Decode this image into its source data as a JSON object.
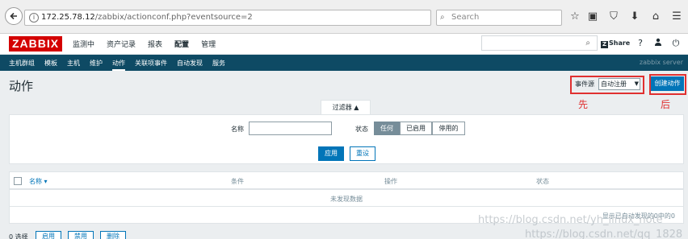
{
  "browser": {
    "url_host": "172.25.78.12",
    "url_path": "/zabbix/actionconf.php?eventsource=2",
    "search_placeholder": "Search"
  },
  "header": {
    "logo": "ZABBIX",
    "menu": [
      "监测中",
      "资产记录",
      "报表",
      "配置",
      "管理"
    ],
    "share_label": "Share",
    "help_label": "?"
  },
  "subnav": {
    "items": [
      "主机群组",
      "模板",
      "主机",
      "维护",
      "动作",
      "关联项事件",
      "自动发现",
      "服务"
    ],
    "server": "zabbix server"
  },
  "page": {
    "title": "动作",
    "event_source_label": "事件源",
    "event_source_value": "自动注册",
    "create_button": "创建动作",
    "annotation_first": "先",
    "annotation_after": "后"
  },
  "filter": {
    "tab_label": "过滤器",
    "name_label": "名称",
    "name_value": "",
    "status_label": "状态",
    "status_options": [
      "任何",
      "已启用",
      "停用的"
    ],
    "apply": "应用",
    "reset": "重设"
  },
  "table": {
    "columns": [
      "名称 ▾",
      "条件",
      "操作",
      "状态"
    ],
    "empty_text": "未发现数据",
    "paging_text": "显示已自动发现的0中的0"
  },
  "bottom": {
    "selected_count": "0 选择",
    "buttons": [
      "启用",
      "禁用",
      "删除"
    ]
  },
  "watermark": {
    "line1": "https://blog.csdn.net/yh_linux_note",
    "line2": "https://blog.csdn.net/qq_1828"
  }
}
